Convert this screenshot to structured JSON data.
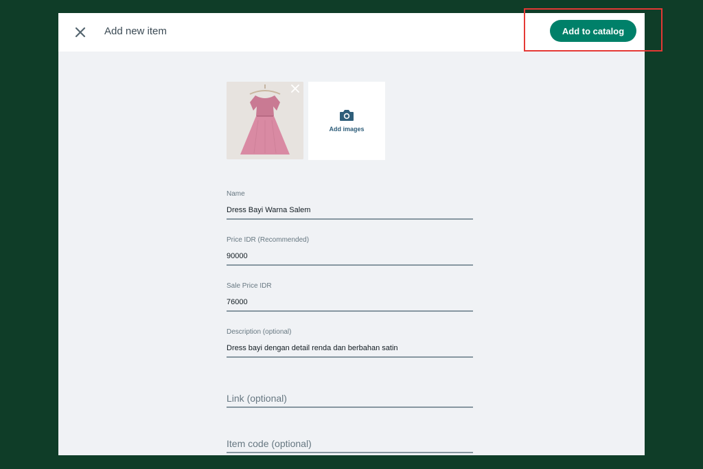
{
  "header": {
    "title": "Add new item",
    "primary_action": "Add to catalog"
  },
  "images": {
    "add_label": "Add images"
  },
  "form": {
    "name": {
      "label": "Name",
      "value": "Dress Bayi Warna Salem"
    },
    "price": {
      "label": "Price IDR (Recommended)",
      "value": "90000"
    },
    "sale_price": {
      "label": "Sale Price IDR",
      "value": "76000"
    },
    "description": {
      "label": "Description (optional)",
      "value": "Dress bayi dengan detail renda dan berbahan satin"
    },
    "link": {
      "placeholder": "Link (optional)"
    },
    "item_code": {
      "placeholder": "Item code (optional)"
    }
  },
  "colors": {
    "accent": "#008069",
    "backdrop": "#0f3d28",
    "highlight": "#e53935",
    "dress": "#d98aa3"
  },
  "icons": [
    "close-icon",
    "camera-icon",
    "remove-image-icon"
  ]
}
